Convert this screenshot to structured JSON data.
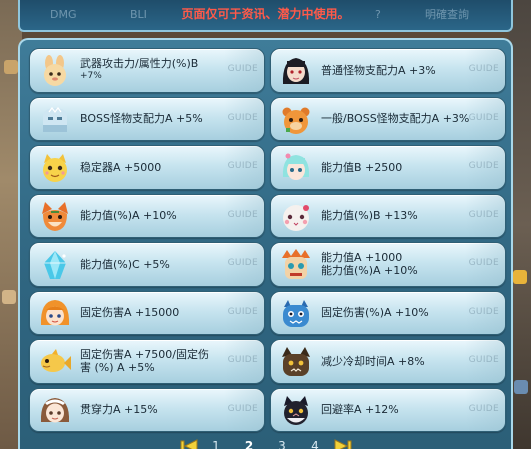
{
  "topbar": {
    "notice": "页面仅可于资讯、潜力中使用。",
    "ghost_tabs": [
      "DMG",
      "BLI",
      "?",
      "明確查詢"
    ]
  },
  "cards": [
    {
      "label": "武器攻击力/属性力(%)B",
      "value": "+7%",
      "icon": "rabbit-icon",
      "guide": "GUIDE"
    },
    {
      "label": "普通怪物支配力A +3%",
      "value": "",
      "icon": "dark-haired-girl-icon",
      "guide": "GUIDE"
    },
    {
      "label": "BOSS怪物支配力A +5%",
      "value": "",
      "icon": "ice-golem-icon",
      "guide": "GUIDE"
    },
    {
      "label": "一般/BOSS怪物支配力A +3%",
      "value": "",
      "icon": "orange-bear-icon",
      "guide": "GUIDE"
    },
    {
      "label": "稳定器A +5000",
      "value": "",
      "icon": "yellow-cat-icon",
      "guide": "GUIDE"
    },
    {
      "label": "能力值B +2500",
      "value": "",
      "icon": "cyan-hair-girl-icon",
      "guide": "GUIDE"
    },
    {
      "label": "能力值(%)A +10%",
      "value": "",
      "icon": "fox-icon",
      "guide": "GUIDE"
    },
    {
      "label": "能力值(%)B +13%",
      "value": "",
      "icon": "white-bunny-icon",
      "guide": "GUIDE"
    },
    {
      "label": "能力值(%)C +5%",
      "value": "",
      "icon": "blue-crystal-icon",
      "guide": "GUIDE"
    },
    {
      "label": "能力值A +1000",
      "value": "能力值(%)A +10%",
      "icon": "tribal-mask-icon",
      "guide": "GUIDE"
    },
    {
      "label": "固定伤害A +15000",
      "value": "",
      "icon": "orange-hood-girl-icon",
      "guide": "GUIDE"
    },
    {
      "label": "固定伤害(%)A +10%",
      "value": "",
      "icon": "blue-monster-icon",
      "guide": "GUIDE"
    },
    {
      "label": "固定伤害A +7500/固定伤",
      "value": "害 (%) A +5%",
      "icon": "yellow-fish-icon",
      "guide": "GUIDE"
    },
    {
      "label": "减少冷却时间A +8%",
      "value": "",
      "icon": "dark-hound-icon",
      "guide": "GUIDE"
    },
    {
      "label": "贯穿力A +15%",
      "value": "",
      "icon": "maid-girl-icon",
      "guide": "GUIDE"
    },
    {
      "label": "回避率A +12%",
      "value": "",
      "icon": "black-cat-icon",
      "guide": "GUIDE"
    }
  ],
  "pagination": {
    "pages": [
      "1",
      "2",
      "3",
      "4"
    ],
    "current": "2"
  },
  "colors": {
    "panel": "#3f7c99",
    "card_top": "#eaf7fc",
    "card_bottom": "#a7cfdf",
    "notice": "#ff5a4a",
    "border": "#a9d8ea"
  }
}
